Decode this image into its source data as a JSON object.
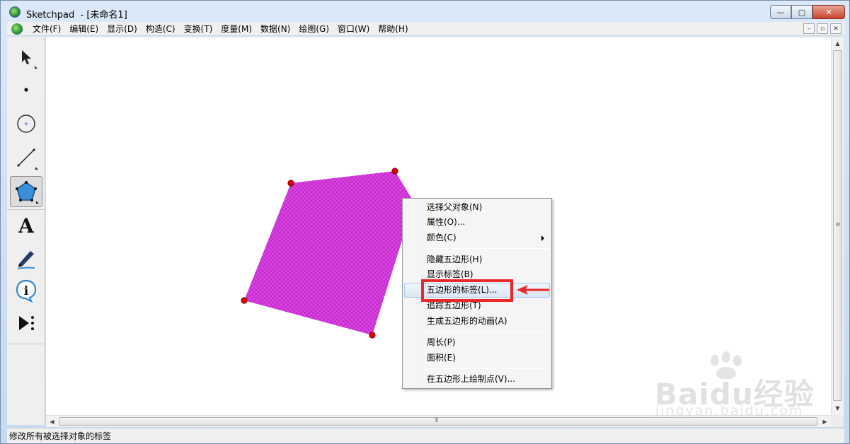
{
  "window": {
    "title": "Sketchpad  - [未命名1]",
    "buttons": {
      "minimize": "—",
      "maximize": "▢",
      "close": "✕"
    }
  },
  "menubar": {
    "items": [
      "文件(F)",
      "编辑(E)",
      "显示(D)",
      "构造(C)",
      "变换(T)",
      "度量(M)",
      "数据(N)",
      "绘图(G)",
      "窗口(W)",
      "帮助(H)"
    ],
    "mdi_buttons": [
      "–",
      "▫",
      "✕"
    ]
  },
  "toolbox": {
    "tools": [
      {
        "name": "arrow-tool",
        "icon": "select-arrow-icon"
      },
      {
        "name": "point-tool",
        "icon": "point-icon"
      },
      {
        "name": "compass-tool",
        "icon": "circle-icon"
      },
      {
        "name": "straightedge-tool",
        "icon": "segment-icon"
      },
      {
        "name": "polygon-tool",
        "icon": "pentagon-icon",
        "active": true
      },
      {
        "name": "text-tool",
        "icon": "text-a-icon",
        "label": "A"
      },
      {
        "name": "marker-tool",
        "icon": "marker-pen-icon"
      },
      {
        "name": "information-tool",
        "icon": "info-icon",
        "label": "i"
      },
      {
        "name": "custom-tool",
        "icon": "custom-tools-icon"
      }
    ]
  },
  "canvas": {
    "polygon_fill_color": "#e040e8",
    "polygon_hatch_color": "#b02cb8",
    "vertex_color": "#e00000"
  },
  "context_menu": {
    "groups": [
      [
        {
          "label": "选择父对象(N)"
        },
        {
          "label": "属性(O)..."
        },
        {
          "label": "颜色(C)",
          "submenu": true
        }
      ],
      [
        {
          "label": "隐藏五边形(H)"
        },
        {
          "label": "显示标签(B)"
        },
        {
          "label": "五边形的标签(L)...",
          "hover": true
        },
        {
          "label": "追踪五边形(T)"
        },
        {
          "label": "生成五边形的动画(A)"
        }
      ],
      [
        {
          "label": "周长(P)"
        },
        {
          "label": "面积(E)"
        }
      ],
      [
        {
          "label": "在五边形上绘制点(V)..."
        }
      ]
    ]
  },
  "statusbar": {
    "text": "修改所有被选择对象的标签"
  },
  "annotation": {
    "highlight_color": "#e8282b"
  },
  "watermark": {
    "main": "Baidu经验",
    "sub": "jingyan.baidu.com"
  }
}
